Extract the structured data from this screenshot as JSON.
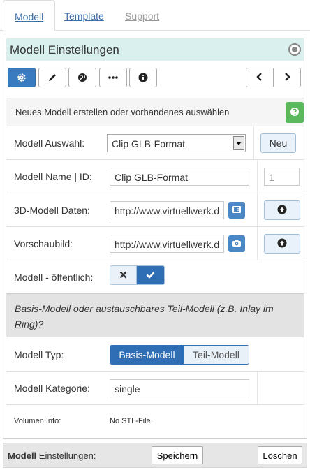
{
  "tabs": [
    {
      "label": "Modell",
      "state": "active"
    },
    {
      "label": "Template",
      "state": "normal"
    },
    {
      "label": "Support",
      "state": "disabled"
    }
  ],
  "panel": {
    "title": "Modell Einstellungen",
    "toolbar": [
      "gear-icon",
      "pencil-icon",
      "globe-icon",
      "ellipsis-icon",
      "info-icon"
    ],
    "nav": [
      "chevron-left-icon",
      "chevron-right-icon"
    ]
  },
  "info": {
    "text": "Neues Modell erstellen oder vorhandenes auswählen",
    "help_icon": "question-icon"
  },
  "form": {
    "modell_auswahl": {
      "label": "Modell Auswahl:",
      "value": "Clip GLB-Format",
      "button": "Neu"
    },
    "modell_name": {
      "label": "Modell Name | ID:",
      "value": "Clip GLB-Format",
      "id": "1"
    },
    "daten_3d": {
      "label": "3D-Modell Daten:",
      "value": "http://www.virtuellwerk.d"
    },
    "vorschaubild": {
      "label": "Vorschaubild:",
      "value": "http://www.virtuellwerk.d"
    },
    "oeffentlich": {
      "label": "Modell - öffentlich:",
      "value": true
    },
    "basis_text": "Basis-Modell oder austauschbares Teil-Modell (z.B. Inlay im Ring)?",
    "typ": {
      "label": "Modell Typ:",
      "options": [
        "Basis-Modell",
        "Teil-Modell"
      ],
      "selected": "Basis-Modell"
    },
    "kategorie": {
      "label": "Modell Kategorie:",
      "value": "single"
    },
    "volumen": {
      "label": "Volumen Info:",
      "value": "No STL-File."
    }
  },
  "footer": {
    "label_bold": "Modell",
    "label_rest": " Einstellungen:",
    "save": "Speichern",
    "delete": "Löschen"
  },
  "colors": {
    "header_bg": "#d9f0ee",
    "primary": "#2f6db5",
    "help": "#5cb85c"
  }
}
